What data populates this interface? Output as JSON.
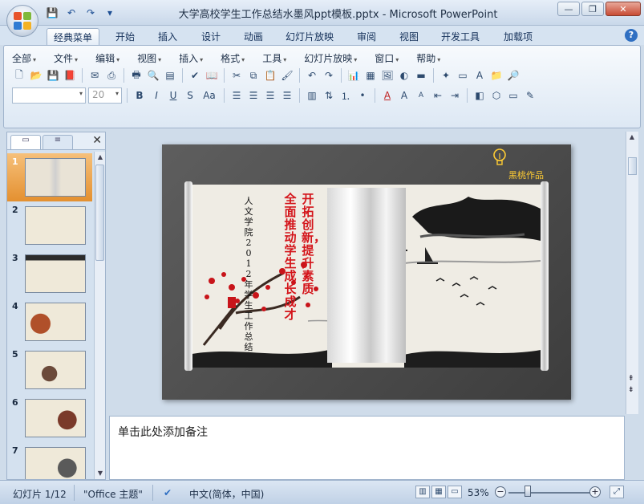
{
  "window": {
    "title": "大学高校学生工作总结水墨风ppt模板.pptx - Microsoft PowerPoint",
    "minimize": "—",
    "restore": "❐",
    "close": "✕"
  },
  "qat": {
    "save": "💾",
    "undo": "↶",
    "redo": "↷",
    "more": "▾"
  },
  "tabs": [
    {
      "label": "经典菜单",
      "active": true
    },
    {
      "label": "开始"
    },
    {
      "label": "插入"
    },
    {
      "label": "设计"
    },
    {
      "label": "动画"
    },
    {
      "label": "幻灯片放映"
    },
    {
      "label": "审阅"
    },
    {
      "label": "视图"
    },
    {
      "label": "开发工具"
    },
    {
      "label": "加载项"
    }
  ],
  "help": "?",
  "menus": [
    "全部",
    "文件",
    "编辑",
    "视图",
    "插入",
    "格式",
    "工具",
    "幻灯片放映",
    "窗口",
    "帮助"
  ],
  "font": {
    "name": "",
    "size": "20"
  },
  "format_buttons": {
    "bold": "B",
    "italic": "I",
    "underline": "U",
    "shadow": "S",
    "case": "Aa"
  },
  "slide_panel": {
    "tab_slides": "▭",
    "tab_outline": "≡",
    "close": "✕",
    "thumbnails": [
      "1",
      "2",
      "3",
      "4",
      "5",
      "6",
      "7"
    ],
    "selected": 1
  },
  "slide": {
    "brand": "黑桃作品",
    "title_red_1": "开拓创新，提升素质",
    "title_red_2": "全面推动学生成长成才",
    "subtitle": "人文学院2012年学生工作总结"
  },
  "notes": {
    "placeholder": "单击此处添加备注"
  },
  "status": {
    "slide": "幻灯片 1/12",
    "theme": "\"Office 主题\"",
    "language": "中文(简体，中国)",
    "zoom": "53%"
  },
  "colors": {
    "accent": "#e49030",
    "ribbon": "#dde8f4",
    "title_red": "#d4141a"
  }
}
